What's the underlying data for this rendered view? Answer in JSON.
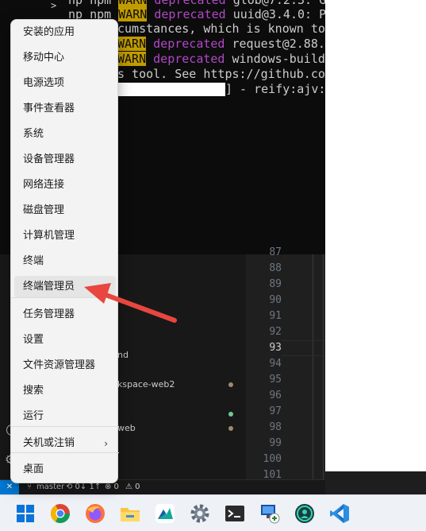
{
  "terminal": {
    "lines": [
      {
        "prefix": "np npm ",
        "level": "WARN",
        "kind": "deprecated",
        "text": " glob@7.2.3: G"
      },
      {
        "prefix": "np npm ",
        "level": "WARN",
        "kind": "deprecated",
        "text": " uuid@3.4.0: P"
      },
      {
        "prefix": "",
        "level": "",
        "kind": "",
        "text": "cumstances, which is known to"
      },
      {
        "prefix": "",
        "level": "WARN",
        "kind": "deprecated",
        "text": " request@2.88.2"
      },
      {
        "prefix": "",
        "level": "WARN",
        "kind": "deprecated",
        "text": " windows-build-"
      },
      {
        "prefix": "",
        "level": "",
        "kind": "",
        "text": "s tool. See https://github.com"
      }
    ],
    "progress_tail": "] - reify:ajv:",
    "chevron": ">"
  },
  "explorer": {
    "items": [
      {
        "label": "nd",
        "dot": ""
      },
      {
        "label": "kspace-web2",
        "dot": "#a1896a"
      },
      {
        "label": "",
        "dot": "#73c991"
      },
      {
        "label": "web",
        "dot": "#a1896a"
      }
    ]
  },
  "gutter": {
    "line_numbers": [
      "87",
      "88",
      "89",
      "90",
      "91",
      "92",
      "93",
      "94",
      "95",
      "96",
      "97",
      "98",
      "99",
      "100",
      "101"
    ],
    "active": "93"
  },
  "statusbar": {
    "remote": "✕",
    "branch": "master",
    "sync": "⟲ 0↓ 1↑",
    "errors": "⊗ 0",
    "warnings": "⚠ 0"
  },
  "menu": {
    "items": [
      {
        "label": "安装的应用",
        "submenu": false
      },
      {
        "label": "移动中心",
        "submenu": false
      },
      {
        "label": "电源选项",
        "submenu": false
      },
      {
        "label": "事件查看器",
        "submenu": false
      },
      {
        "label": "系统",
        "submenu": false
      },
      {
        "label": "设备管理器",
        "submenu": false
      },
      {
        "label": "网络连接",
        "submenu": false
      },
      {
        "label": "磁盘管理",
        "submenu": false
      },
      {
        "label": "计算机管理",
        "submenu": false
      },
      {
        "label": "终端",
        "submenu": false
      },
      {
        "label": "终端管理员",
        "submenu": false,
        "hover": true
      },
      {
        "label": "任务管理器",
        "submenu": false
      },
      {
        "label": "设置",
        "submenu": false
      },
      {
        "label": "文件资源管理器",
        "submenu": false
      },
      {
        "label": "搜索",
        "submenu": false
      },
      {
        "label": "运行",
        "submenu": false
      },
      {
        "label": "关机或注销",
        "submenu": true
      },
      {
        "label": "桌面",
        "submenu": false
      }
    ]
  },
  "taskbar": {
    "apps": [
      "windows-start-icon",
      "chrome-icon",
      "firefox-icon",
      "file-explorer-icon",
      "app-icon",
      "settings-gear-icon",
      "terminal-icon",
      "remote-desktop-icon",
      "teal-app-icon",
      "vscode-icon"
    ]
  },
  "colors": {
    "accent": "#0078d4",
    "warn_bg": "#c19c00",
    "deprecated": "#b148c6",
    "annotation": "#e8463f"
  }
}
